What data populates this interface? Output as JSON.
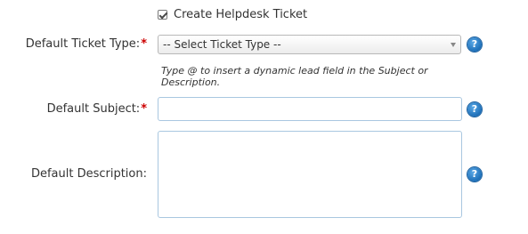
{
  "checkbox": {
    "label": "Create Helpdesk Ticket",
    "checked": true
  },
  "ticket_type": {
    "label": "Default Ticket Type:",
    "required_mark": "*",
    "selected": "-- Select Ticket Type --",
    "hint": "Type @ to insert a dynamic lead field in the Subject or Description."
  },
  "subject": {
    "label": "Default Subject:",
    "required_mark": "*",
    "value": ""
  },
  "description": {
    "label": "Default Description:",
    "value": ""
  },
  "help": {
    "glyph": "?"
  },
  "colors": {
    "required": "#cc0000",
    "help_icon": "#1d6fb8",
    "input_border": "#a9c7e0"
  }
}
